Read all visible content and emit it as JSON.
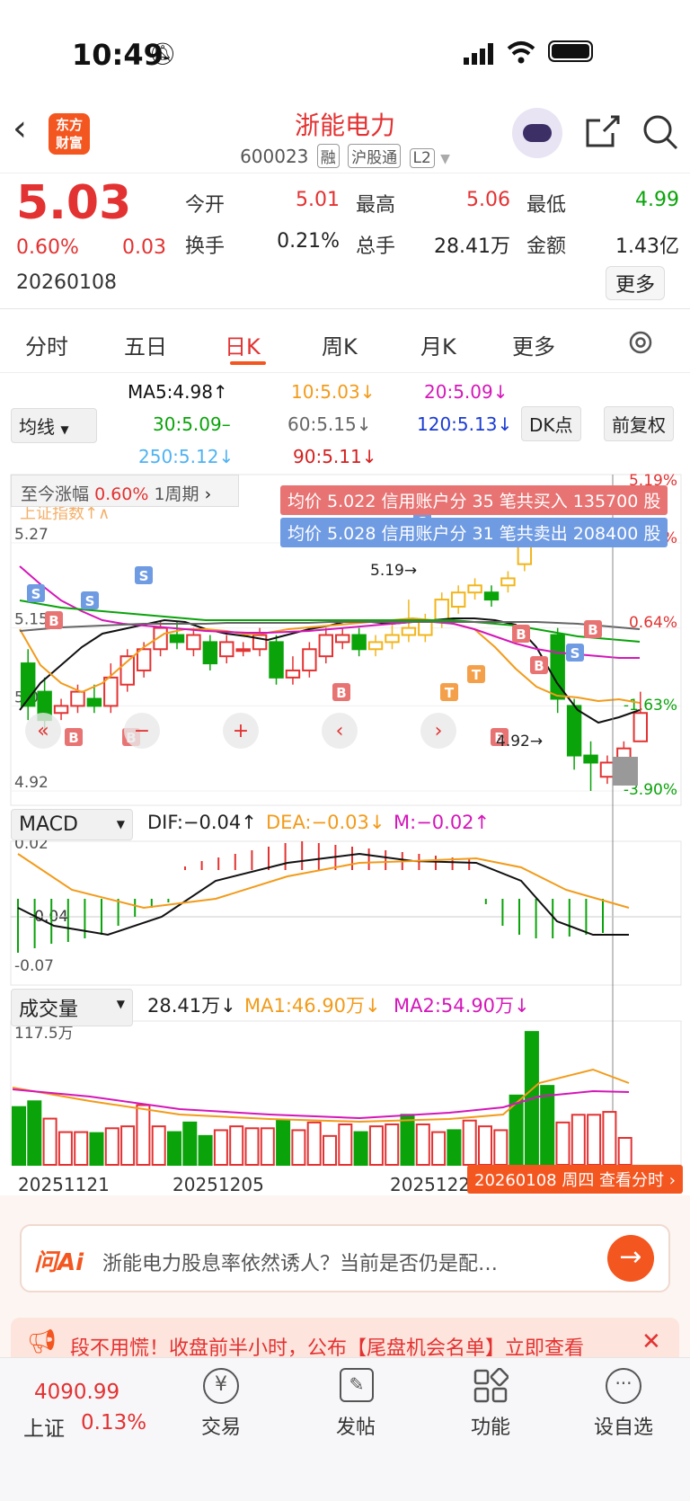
{
  "status": {
    "time": "10:49"
  },
  "header": {
    "title": "浙能电力",
    "code": "600023",
    "tags": [
      "融",
      "沪股通",
      "L2"
    ],
    "logo": "东方\n财富"
  },
  "quote": {
    "price": "5.03",
    "change_pct": "0.60%",
    "change": "0.03",
    "date": "20260108",
    "open_label": "今开",
    "open": "5.01",
    "high_label": "最高",
    "high": "5.06",
    "low_label": "最低",
    "low": "4.99",
    "turnover_label": "换手",
    "turnover": "0.21%",
    "volume_label": "总手",
    "volume": "28.41万",
    "amount_label": "金额",
    "amount": "1.43亿",
    "more": "更多"
  },
  "tabs": [
    "分时",
    "五日",
    "日K",
    "周K",
    "月K",
    "更多"
  ],
  "active_tab": "日K",
  "ma": {
    "selector": "均线",
    "ma5": "MA5:4.98↑",
    "ma10": "10:5.03↓",
    "ma20": "20:5.09↓",
    "ma30": "30:5.09–",
    "ma60": "60:5.15↓",
    "ma120": "120:5.13↓",
    "ma250": "250:5.12↓",
    "ma90": "90:5.11↓",
    "dk": "DK点",
    "fq": "前复权"
  },
  "kline": {
    "period_label": "至今涨幅",
    "period_pct": "0.60%",
    "period_unit": "1周期",
    "buy_banner": "均价 5.022 信用账户分 35 笔共买入 135700 股",
    "sell_banner": "均价 5.028 信用账户分 31 笔共卖出 208400 股",
    "ghost_label": "上证指数↑∧",
    "y_labels": [
      "5.27",
      "5.15",
      "5.04",
      "4.92"
    ],
    "pct_labels": [
      "5.19%",
      "2.91%",
      "0.64%",
      "-1.63%",
      "-3.90%"
    ],
    "high_mark": "5.19→",
    "low_mark": "4.92→"
  },
  "chart_data": {
    "type": "candlestick",
    "y_range": [
      4.92,
      5.27
    ],
    "candles": [
      [
        5.1,
        5.04,
        5.12,
        5.02
      ],
      [
        5.06,
        5.02,
        5.08,
        5.0
      ],
      [
        5.03,
        5.04,
        5.05,
        5.02
      ],
      [
        5.04,
        5.06,
        5.07,
        5.03
      ],
      [
        5.05,
        5.04,
        5.07,
        5.03
      ],
      [
        5.04,
        5.08,
        5.1,
        5.03
      ],
      [
        5.07,
        5.11,
        5.12,
        5.06
      ],
      [
        5.09,
        5.12,
        5.13,
        5.08
      ],
      [
        5.12,
        5.15,
        5.16,
        5.11
      ],
      [
        5.14,
        5.13,
        5.16,
        5.12
      ],
      [
        5.12,
        5.14,
        5.15,
        5.11
      ],
      [
        5.13,
        5.1,
        5.14,
        5.09
      ],
      [
        5.11,
        5.13,
        5.14,
        5.1
      ],
      [
        5.12,
        5.12,
        5.13,
        5.11
      ],
      [
        5.12,
        5.14,
        5.15,
        5.11
      ],
      [
        5.13,
        5.08,
        5.14,
        5.07
      ],
      [
        5.08,
        5.09,
        5.11,
        5.07
      ],
      [
        5.09,
        5.12,
        5.13,
        5.08
      ],
      [
        5.11,
        5.14,
        5.15,
        5.1
      ],
      [
        5.13,
        5.14,
        5.15,
        5.12
      ],
      [
        5.14,
        5.12,
        5.15,
        5.11
      ],
      [
        5.12,
        5.13,
        5.14,
        5.11
      ],
      [
        5.13,
        5.14,
        5.16,
        5.12
      ],
      [
        5.14,
        5.15,
        5.19,
        5.13
      ],
      [
        5.14,
        5.16,
        5.17,
        5.13
      ],
      [
        5.16,
        5.19,
        5.2,
        5.15
      ],
      [
        5.18,
        5.2,
        5.21,
        5.17
      ],
      [
        5.2,
        5.21,
        5.22,
        5.19
      ],
      [
        5.2,
        5.19,
        5.21,
        5.18
      ],
      [
        5.21,
        5.22,
        5.23,
        5.2
      ],
      [
        5.24,
        5.27,
        5.29,
        5.23
      ],
      [
        5.28,
        5.32,
        5.33,
        5.27
      ],
      [
        5.14,
        5.05,
        5.15,
        5.03
      ],
      [
        5.04,
        4.97,
        5.05,
        4.95
      ],
      [
        4.97,
        4.96,
        4.99,
        4.92
      ],
      [
        4.94,
        4.96,
        4.97,
        4.93
      ],
      [
        4.96,
        4.98,
        4.99,
        4.95
      ],
      [
        4.99,
        5.03,
        5.06,
        4.99
      ]
    ]
  },
  "macd": {
    "selector": "MACD",
    "dif": "DIF:−0.04↑",
    "dea": "DEA:−0.03↓",
    "m": "M:−0.02↑",
    "y_top": "0.02",
    "y_mid": "-0.04",
    "y_bot": "-0.07"
  },
  "volume": {
    "selector": "成交量",
    "current": "28.41万↓",
    "ma1": "MA1:46.90万↓",
    "ma2": "MA2:54.90万↓",
    "y_top": "117.5万",
    "bars": [
      60,
      66,
      48,
      34,
      34,
      33,
      38,
      40,
      62,
      40,
      34,
      44,
      30,
      36,
      40,
      38,
      38,
      46,
      36,
      44,
      30,
      42,
      34,
      40,
      42,
      52,
      42,
      34,
      36,
      46,
      40,
      36,
      72,
      138,
      82,
      44,
      52,
      52,
      55,
      28
    ],
    "colors": [
      "g",
      "g",
      "r",
      "r",
      "r",
      "g",
      "r",
      "r",
      "r",
      "r",
      "g",
      "g",
      "g",
      "r",
      "r",
      "r",
      "r",
      "g",
      "r",
      "r",
      "r",
      "r",
      "g",
      "r",
      "r",
      "g",
      "r",
      "r",
      "g",
      "r",
      "r",
      "r",
      "g",
      "g",
      "g",
      "r",
      "r",
      "r",
      "r",
      "r"
    ]
  },
  "dates": [
    "20251121",
    "20251205",
    "20251222",
    "20260108 周四 查看分时"
  ],
  "ask_ai": {
    "label": "问Ai",
    "placeholder": "浙能电力股息率依然诱人？当前是否仍是配…"
  },
  "notice": "段不用慌！收盘前半小时，公布【尾盘机会名单】立即查看",
  "bottom": {
    "index_value": "4090.99",
    "index_name": "上证",
    "index_pct": "0.13%",
    "items": [
      "交易",
      "发帖",
      "功能",
      "设自选"
    ]
  }
}
